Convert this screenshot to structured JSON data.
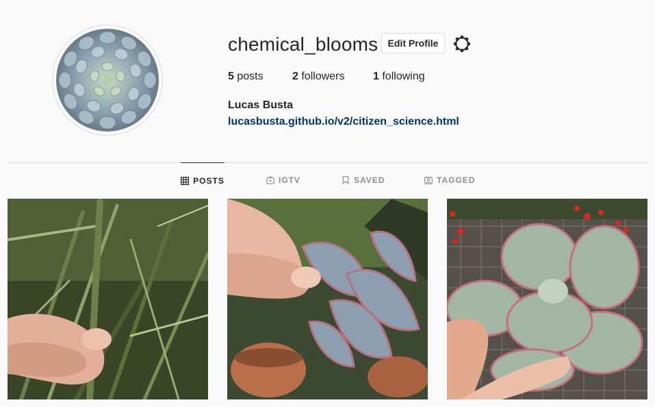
{
  "profile": {
    "username": "chemical_blooms",
    "edit_label": "Edit Profile",
    "settings_icon": "gear-icon",
    "full_name": "Lucas Busta",
    "website": "lucasbusta.github.io/v2/citizen_science.html"
  },
  "stats": {
    "posts_count": "5",
    "posts_label": "posts",
    "followers_count": "2",
    "followers_label": "followers",
    "following_count": "1",
    "following_label": "following"
  },
  "tabs": [
    {
      "label": "POSTS",
      "icon": "grid-icon",
      "active": true
    },
    {
      "label": "IGTV",
      "icon": "igtv-icon",
      "active": false
    },
    {
      "label": "SAVED",
      "icon": "bookmark-icon",
      "active": false
    },
    {
      "label": "TAGGED",
      "icon": "tagged-icon",
      "active": false
    }
  ],
  "colors": {
    "text": "#262626",
    "muted": "#8e8e8e",
    "link": "#003569",
    "border": "#dbdbdb",
    "background": "#fafafa"
  }
}
